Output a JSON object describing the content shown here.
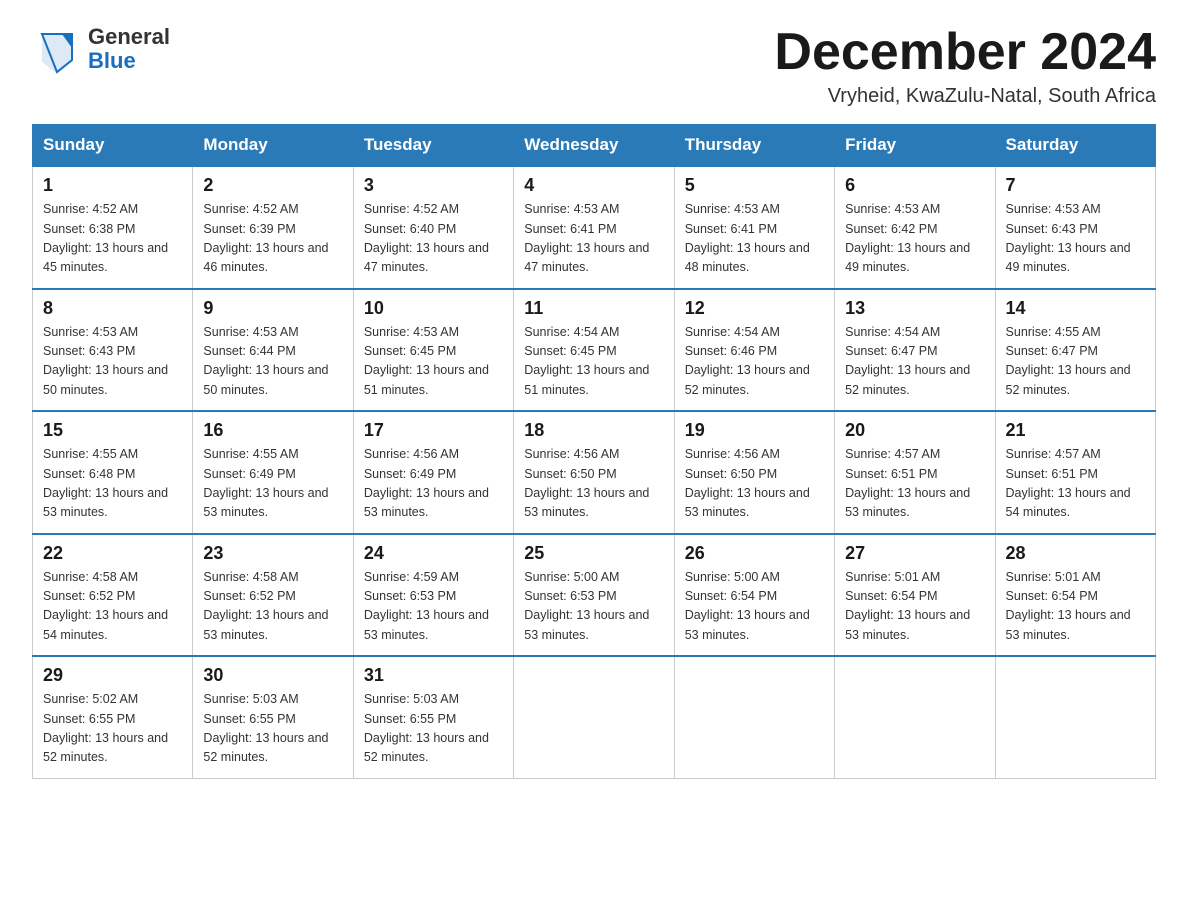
{
  "header": {
    "logo_general": "General",
    "logo_blue": "Blue",
    "title": "December 2024",
    "subtitle": "Vryheid, KwaZulu-Natal, South Africa"
  },
  "weekdays": [
    "Sunday",
    "Monday",
    "Tuesday",
    "Wednesday",
    "Thursday",
    "Friday",
    "Saturday"
  ],
  "weeks": [
    [
      {
        "day": "1",
        "sunrise": "Sunrise: 4:52 AM",
        "sunset": "Sunset: 6:38 PM",
        "daylight": "Daylight: 13 hours and 45 minutes."
      },
      {
        "day": "2",
        "sunrise": "Sunrise: 4:52 AM",
        "sunset": "Sunset: 6:39 PM",
        "daylight": "Daylight: 13 hours and 46 minutes."
      },
      {
        "day": "3",
        "sunrise": "Sunrise: 4:52 AM",
        "sunset": "Sunset: 6:40 PM",
        "daylight": "Daylight: 13 hours and 47 minutes."
      },
      {
        "day": "4",
        "sunrise": "Sunrise: 4:53 AM",
        "sunset": "Sunset: 6:41 PM",
        "daylight": "Daylight: 13 hours and 47 minutes."
      },
      {
        "day": "5",
        "sunrise": "Sunrise: 4:53 AM",
        "sunset": "Sunset: 6:41 PM",
        "daylight": "Daylight: 13 hours and 48 minutes."
      },
      {
        "day": "6",
        "sunrise": "Sunrise: 4:53 AM",
        "sunset": "Sunset: 6:42 PM",
        "daylight": "Daylight: 13 hours and 49 minutes."
      },
      {
        "day": "7",
        "sunrise": "Sunrise: 4:53 AM",
        "sunset": "Sunset: 6:43 PM",
        "daylight": "Daylight: 13 hours and 49 minutes."
      }
    ],
    [
      {
        "day": "8",
        "sunrise": "Sunrise: 4:53 AM",
        "sunset": "Sunset: 6:43 PM",
        "daylight": "Daylight: 13 hours and 50 minutes."
      },
      {
        "day": "9",
        "sunrise": "Sunrise: 4:53 AM",
        "sunset": "Sunset: 6:44 PM",
        "daylight": "Daylight: 13 hours and 50 minutes."
      },
      {
        "day": "10",
        "sunrise": "Sunrise: 4:53 AM",
        "sunset": "Sunset: 6:45 PM",
        "daylight": "Daylight: 13 hours and 51 minutes."
      },
      {
        "day": "11",
        "sunrise": "Sunrise: 4:54 AM",
        "sunset": "Sunset: 6:45 PM",
        "daylight": "Daylight: 13 hours and 51 minutes."
      },
      {
        "day": "12",
        "sunrise": "Sunrise: 4:54 AM",
        "sunset": "Sunset: 6:46 PM",
        "daylight": "Daylight: 13 hours and 52 minutes."
      },
      {
        "day": "13",
        "sunrise": "Sunrise: 4:54 AM",
        "sunset": "Sunset: 6:47 PM",
        "daylight": "Daylight: 13 hours and 52 minutes."
      },
      {
        "day": "14",
        "sunrise": "Sunrise: 4:55 AM",
        "sunset": "Sunset: 6:47 PM",
        "daylight": "Daylight: 13 hours and 52 minutes."
      }
    ],
    [
      {
        "day": "15",
        "sunrise": "Sunrise: 4:55 AM",
        "sunset": "Sunset: 6:48 PM",
        "daylight": "Daylight: 13 hours and 53 minutes."
      },
      {
        "day": "16",
        "sunrise": "Sunrise: 4:55 AM",
        "sunset": "Sunset: 6:49 PM",
        "daylight": "Daylight: 13 hours and 53 minutes."
      },
      {
        "day": "17",
        "sunrise": "Sunrise: 4:56 AM",
        "sunset": "Sunset: 6:49 PM",
        "daylight": "Daylight: 13 hours and 53 minutes."
      },
      {
        "day": "18",
        "sunrise": "Sunrise: 4:56 AM",
        "sunset": "Sunset: 6:50 PM",
        "daylight": "Daylight: 13 hours and 53 minutes."
      },
      {
        "day": "19",
        "sunrise": "Sunrise: 4:56 AM",
        "sunset": "Sunset: 6:50 PM",
        "daylight": "Daylight: 13 hours and 53 minutes."
      },
      {
        "day": "20",
        "sunrise": "Sunrise: 4:57 AM",
        "sunset": "Sunset: 6:51 PM",
        "daylight": "Daylight: 13 hours and 53 minutes."
      },
      {
        "day": "21",
        "sunrise": "Sunrise: 4:57 AM",
        "sunset": "Sunset: 6:51 PM",
        "daylight": "Daylight: 13 hours and 54 minutes."
      }
    ],
    [
      {
        "day": "22",
        "sunrise": "Sunrise: 4:58 AM",
        "sunset": "Sunset: 6:52 PM",
        "daylight": "Daylight: 13 hours and 54 minutes."
      },
      {
        "day": "23",
        "sunrise": "Sunrise: 4:58 AM",
        "sunset": "Sunset: 6:52 PM",
        "daylight": "Daylight: 13 hours and 53 minutes."
      },
      {
        "day": "24",
        "sunrise": "Sunrise: 4:59 AM",
        "sunset": "Sunset: 6:53 PM",
        "daylight": "Daylight: 13 hours and 53 minutes."
      },
      {
        "day": "25",
        "sunrise": "Sunrise: 5:00 AM",
        "sunset": "Sunset: 6:53 PM",
        "daylight": "Daylight: 13 hours and 53 minutes."
      },
      {
        "day": "26",
        "sunrise": "Sunrise: 5:00 AM",
        "sunset": "Sunset: 6:54 PM",
        "daylight": "Daylight: 13 hours and 53 minutes."
      },
      {
        "day": "27",
        "sunrise": "Sunrise: 5:01 AM",
        "sunset": "Sunset: 6:54 PM",
        "daylight": "Daylight: 13 hours and 53 minutes."
      },
      {
        "day": "28",
        "sunrise": "Sunrise: 5:01 AM",
        "sunset": "Sunset: 6:54 PM",
        "daylight": "Daylight: 13 hours and 53 minutes."
      }
    ],
    [
      {
        "day": "29",
        "sunrise": "Sunrise: 5:02 AM",
        "sunset": "Sunset: 6:55 PM",
        "daylight": "Daylight: 13 hours and 52 minutes."
      },
      {
        "day": "30",
        "sunrise": "Sunrise: 5:03 AM",
        "sunset": "Sunset: 6:55 PM",
        "daylight": "Daylight: 13 hours and 52 minutes."
      },
      {
        "day": "31",
        "sunrise": "Sunrise: 5:03 AM",
        "sunset": "Sunset: 6:55 PM",
        "daylight": "Daylight: 13 hours and 52 minutes."
      },
      null,
      null,
      null,
      null
    ]
  ]
}
